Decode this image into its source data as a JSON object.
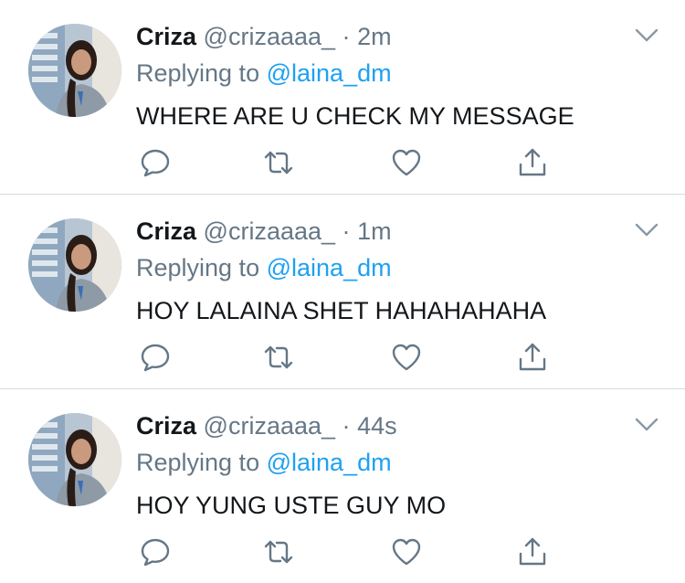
{
  "tweets": [
    {
      "name": "Criza",
      "handle": "@crizaaaa_",
      "separator": "·",
      "time": "2m",
      "replying_prefix": "Replying to",
      "replying_to": "@laina_dm",
      "text": "WHERE ARE U CHECK MY MESSAGE"
    },
    {
      "name": "Criza",
      "handle": "@crizaaaa_",
      "separator": "·",
      "time": "1m",
      "replying_prefix": "Replying to",
      "replying_to": "@laina_dm",
      "text": "HOY LALAINA SHET HAHAHAHAHA"
    },
    {
      "name": "Criza",
      "handle": "@crizaaaa_",
      "separator": "·",
      "time": "44s",
      "replying_prefix": "Replying to",
      "replying_to": "@laina_dm",
      "text": "HOY YUNG USTE GUY MO"
    }
  ],
  "icons": {
    "avatar": "profile-photo",
    "menu": "chevron-down-icon",
    "reply": "reply-icon",
    "retweet": "retweet-icon",
    "like": "heart-icon",
    "share": "share-icon"
  },
  "colors": {
    "text": "#14171a",
    "secondary": "#657786",
    "link": "#1da1f2",
    "divider": "#d6dbe0"
  }
}
